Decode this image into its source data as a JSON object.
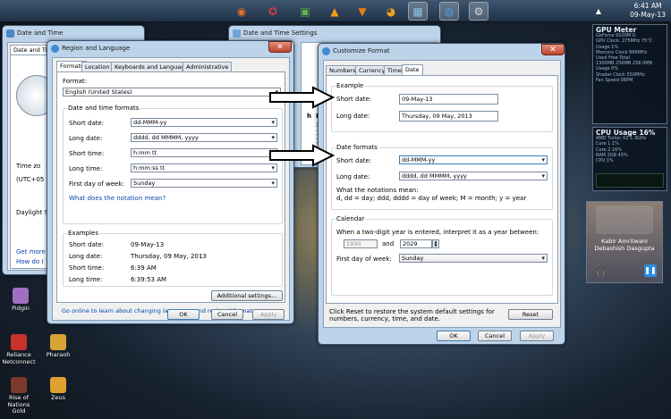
{
  "taskbar": {
    "apps": [
      {
        "icon": "firefox-icon",
        "glyph": "◉",
        "color": "#e8702a"
      },
      {
        "icon": "ccleaner-icon",
        "glyph": "✪",
        "color": "#d43b3b"
      },
      {
        "icon": "green-app-icon",
        "glyph": "▣",
        "color": "#5fb548"
      },
      {
        "icon": "avast-icon",
        "glyph": "▲",
        "color": "#f39c12"
      },
      {
        "icon": "vlc-icon",
        "glyph": "▼",
        "color": "#f07c10"
      },
      {
        "icon": "orange-app-icon",
        "glyph": "◕",
        "color": "#f0a020"
      },
      {
        "icon": "control-panel-icon",
        "glyph": "▦",
        "color": "#8fc0e8"
      },
      {
        "icon": "globe-icon",
        "glyph": "◍",
        "color": "#4aa0e0"
      },
      {
        "icon": "tools-icon",
        "glyph": "⚙",
        "color": "#cfd8e0"
      }
    ],
    "clock_time": "6:41 AM",
    "clock_date": "09-May-13"
  },
  "gadgets": {
    "gpu_title": "GPU Meter",
    "gpu_lines": [
      "GeForce 9100M G",
      "GPU Clock: 275MHz   75°C",
      "Usage  1%",
      "Memory Clock 666MHz",
      "Used       Free      Total",
      "1300MB    256MB    256.0MB",
      "Usage 0%",
      "Shader Clock 550MHz",
      "Fan Speed 0RPM"
    ],
    "cpu_title": "CPU Usage",
    "cpu_percent": "16%",
    "cpu_lines": [
      "AMD Turion X2 1.3GHz",
      "Core 1  1%",
      "Core 2  16%",
      "RAM  2GB  45%",
      "CPU  1%"
    ]
  },
  "media": {
    "line1": "Kabir Amritwani",
    "line2": "Debashish Dasgupta"
  },
  "desktop_icons": [
    "Pidgin",
    "Reliance Netconnect",
    "Pharaoh",
    "Rise of Nations Gold",
    "Zeus"
  ],
  "date_time_window": {
    "title": "Date and Time",
    "tab": "Date and Time",
    "time_zone_label": "Time zo",
    "utc_label": "(UTC+05",
    "daylight_label": "Daylight S",
    "get_more_link": "Get more",
    "how_link": "How do I"
  },
  "dts_window": {
    "title": "Date and Time Settings",
    "col_h": "h",
    "col_fr": "Fr",
    "nums": [
      "3",
      "10",
      "17",
      "24",
      "31"
    ]
  },
  "region_window": {
    "title": "Region and Language",
    "tabs": [
      "Formats",
      "Location",
      "Keyboards and Languages",
      "Administrative"
    ],
    "format_label": "Format:",
    "format_value": "English (United States)",
    "dtf_title": "Date and time formats",
    "rows": [
      {
        "label": "Short date:",
        "value": "dd-MMM-yy"
      },
      {
        "label": "Long date:",
        "value": "dddd, dd MMMM, yyyy"
      },
      {
        "label": "Short time:",
        "value": "h:mm tt"
      },
      {
        "label": "Long time:",
        "value": "h:mm:ss tt"
      },
      {
        "label": "First day of week:",
        "value": "Sunday"
      }
    ],
    "notation_link": "What does the notation mean?",
    "examples_title": "Examples",
    "examples": [
      {
        "label": "Short date:",
        "value": "09-May-13"
      },
      {
        "label": "Long date:",
        "value": "Thursday, 09 May, 2013"
      },
      {
        "label": "Short time:",
        "value": "6:39 AM"
      },
      {
        "label": "Long time:",
        "value": "6:39:53 AM"
      }
    ],
    "additional_button": "Additional settings...",
    "online_link": "Go online to learn about changing languages and regional formats",
    "ok": "OK",
    "cancel": "Cancel",
    "apply": "Apply"
  },
  "customize_window": {
    "title": "Customize Format",
    "tabs": [
      "Numbers",
      "Currency",
      "Time",
      "Date"
    ],
    "example_title": "Example",
    "ex_short_label": "Short date:",
    "ex_short_value": "09-May-13",
    "ex_long_label": "Long date:",
    "ex_long_value": "Thursday, 09 May, 2013",
    "formats_title": "Date formats",
    "short_label": "Short date:",
    "short_value": "dd-MMM-yy",
    "long_label": "Long date:",
    "long_value": "dddd, dd MMMM, yyyy",
    "notation_title": "What the notations mean:",
    "notation_text": "d, dd = day;  ddd, dddd = day of week;  M = month;  y = year",
    "calendar_title": "Calendar",
    "two_digit_text": "When a two-digit year is entered, interpret it as a year between:",
    "year_from": "1930",
    "and_label": "and",
    "year_to": "2029",
    "first_day_label": "First day of week:",
    "first_day_value": "Sunday",
    "reset_text_1": "Click Reset to restore the system default settings for",
    "reset_text_2": "numbers, currency, time, and date.",
    "reset": "Reset",
    "ok": "OK",
    "cancel": "Cancel",
    "apply": "Apply"
  }
}
